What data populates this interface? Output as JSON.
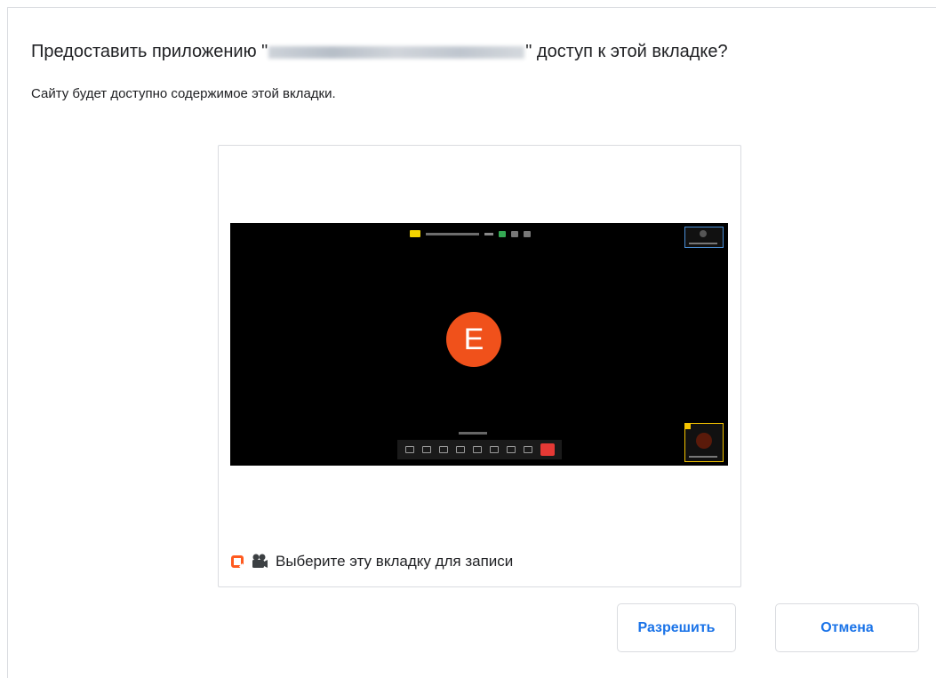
{
  "dialog": {
    "title_prefix": "Предоставить приложению \"",
    "title_suffix": "\" доступ к этой вкладке?",
    "subtitle": "Сайту будет доступно содержимое этой вкладки."
  },
  "preview": {
    "avatar_letter": "E",
    "caption": "Выберите эту вкладку для записи"
  },
  "buttons": {
    "allow": "Разрешить",
    "cancel": "Отмена"
  },
  "colors": {
    "accent": "#1a73e8",
    "avatar": "#f0511b",
    "end_call": "#e53935",
    "favicon": "#ff5a1f"
  },
  "icons": [
    "site-favicon-icon",
    "recording-icon",
    "end-call-icon"
  ]
}
